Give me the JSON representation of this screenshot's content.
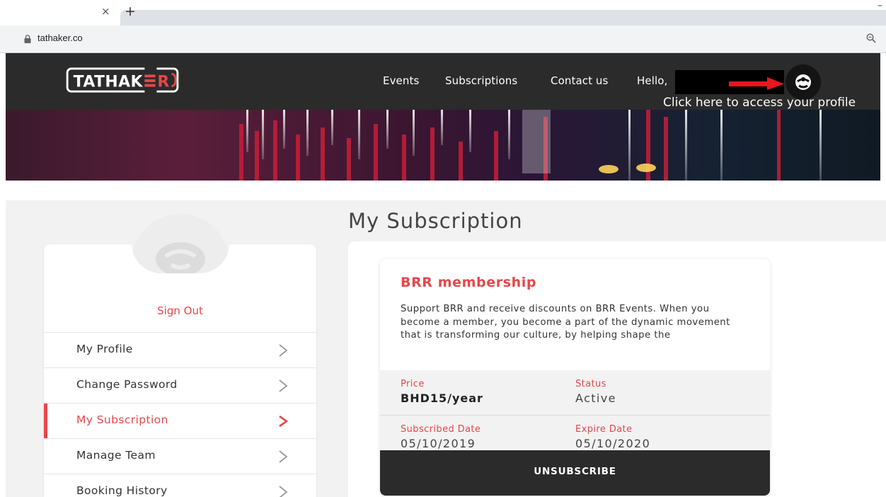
{
  "browser": {
    "tab_close": "×",
    "new_tab": "+",
    "minimize": "–",
    "url": "tathaker.co"
  },
  "header": {
    "logo_text": "TATHAKER",
    "nav": [
      "Events",
      "Subscriptions",
      "Contact us",
      "Hello,"
    ],
    "profile_hint": "Click here to access your profile",
    "accent_color": "#e5474b"
  },
  "page": {
    "title": "My Subscription"
  },
  "sidebar": {
    "sign_out": "Sign Out",
    "items": [
      {
        "label": "My Profile",
        "active": false
      },
      {
        "label": "Change Password",
        "active": false
      },
      {
        "label": "My Subscription",
        "active": true
      },
      {
        "label": "Manage Team",
        "active": false
      },
      {
        "label": "Booking History",
        "active": false
      }
    ]
  },
  "subscription": {
    "name": "BRR membership",
    "description": "Support BRR and receive discounts on BRR Events. When you become a member, you become a part of the dynamic movement that is transforming our culture, by helping shape the",
    "price_label": "Price",
    "price": "BHD15/year",
    "status_label": "Status",
    "status": "Active",
    "subscribed_label": "Subscribed Date",
    "subscribed_date": "05/10/2019",
    "expire_label": "Expire Date",
    "expire_date": "05/10/2020",
    "unsubscribe_label": "UNSUBSCRIBE"
  }
}
